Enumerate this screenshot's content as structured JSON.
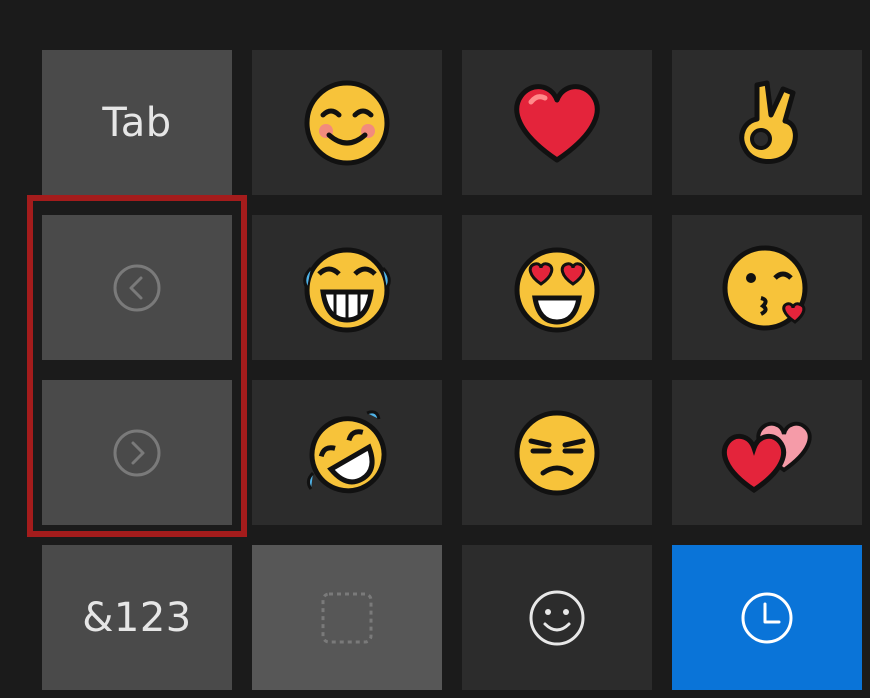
{
  "keyboard": {
    "tab_label": "Tab",
    "numbers_label": "&123",
    "highlight_color": "#a41c1c",
    "accent_color": "#0a74d8"
  },
  "emoji_grid": [
    {
      "name": "smiling-face-with-smiling-eyes",
      "glyph": "😊"
    },
    {
      "name": "red-heart",
      "glyph": "❤️"
    },
    {
      "name": "ok-hand",
      "glyph": "👌"
    },
    {
      "name": "face-with-tears-of-joy",
      "glyph": "😂"
    },
    {
      "name": "smiling-face-with-heart-eyes",
      "glyph": "😍"
    },
    {
      "name": "face-blowing-a-kiss",
      "glyph": "😘"
    },
    {
      "name": "rolling-on-the-floor-laughing",
      "glyph": "🤣"
    },
    {
      "name": "unamused-face",
      "glyph": "😒"
    },
    {
      "name": "two-hearts",
      "glyph": "💕"
    }
  ],
  "icons": {
    "prev": "chevron-left-circle-icon",
    "next": "chevron-right-circle-icon",
    "category_blank": "dashed-square-icon",
    "category_smiley": "smiley-icon",
    "category_recent": "clock-icon"
  }
}
